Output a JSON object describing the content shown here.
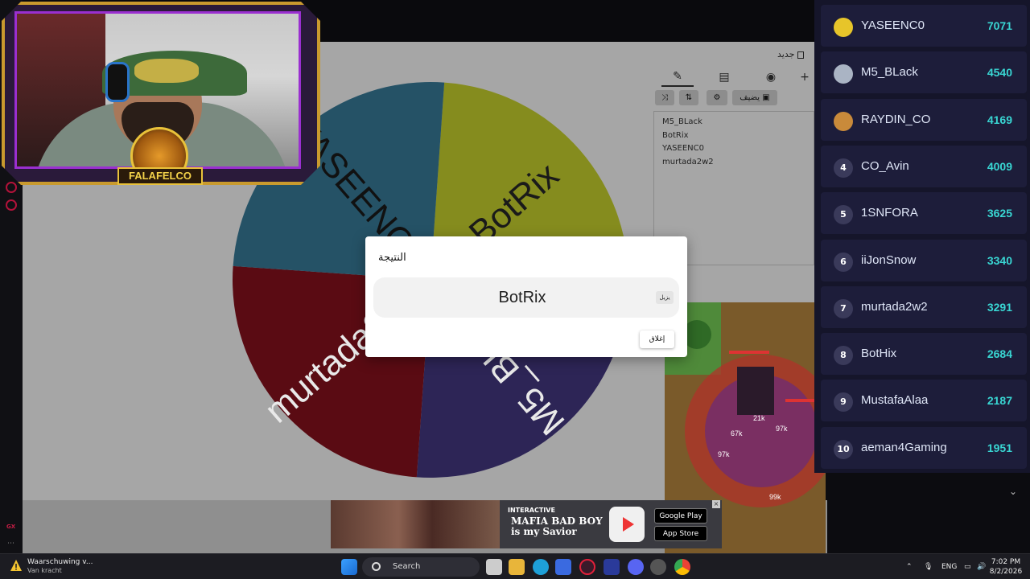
{
  "wheel": {
    "labels": [
      "BotRix",
      "M5_BLack",
      "murtada2w2",
      "YASEENC0"
    ],
    "colors": [
      "#b9c22a",
      "#3f3477",
      "#7d0f1a",
      "#33728d"
    ]
  },
  "editor": {
    "new_label": "جديد",
    "add_label": "يضيف",
    "entries": [
      "M5_BLack",
      "BotRix",
      "YASEENC0",
      "murtada2w2"
    ]
  },
  "modal": {
    "title": "النتيجة",
    "result": "BotRix",
    "remove_label": "يزيل",
    "close_label": "إغلاق"
  },
  "webcam": {
    "logo_text": "FALAFELCO"
  },
  "leaderboard": [
    {
      "rank": "",
      "name": "YASEENC0",
      "score": "7071",
      "color": "#e7c52a"
    },
    {
      "rank": "",
      "name": "M5_BLack",
      "score": "4540",
      "color": "#aab4c4"
    },
    {
      "rank": "",
      "name": "RAYDIN_CO",
      "score": "4169",
      "color": "#c98a3a"
    },
    {
      "rank": "4",
      "name": "CO_Avin",
      "score": "4009",
      "color": "#3a3a5a"
    },
    {
      "rank": "5",
      "name": "1SNFORA",
      "score": "3625",
      "color": "#3a3a5a"
    },
    {
      "rank": "6",
      "name": "iiJonSnow",
      "score": "3340",
      "color": "#3a3a5a"
    },
    {
      "rank": "7",
      "name": "murtada2w2",
      "score": "3291",
      "color": "#3a3a5a"
    },
    {
      "rank": "8",
      "name": "BotHix",
      "score": "2684",
      "color": "#3a3a5a"
    },
    {
      "rank": "9",
      "name": "MustafaAlaa",
      "score": "2187",
      "color": "#3a3a5a"
    },
    {
      "rank": "10",
      "name": "aeman4Gaming",
      "score": "1951",
      "color": "#3a3a5a"
    }
  ],
  "ad": {
    "brand": "INTERACTIVE",
    "title_line1": "MAFIA BAD BOY",
    "title_line2": "is my Savior",
    "google_play": "Google Play",
    "app_store": "App Store"
  },
  "taskbar": {
    "warning_title": "Waarschuwing v...",
    "warning_sub": "Van kracht",
    "search_label": "Search",
    "language": "ENG",
    "time": "7:02 PM",
    "date": "8/2/2026"
  }
}
